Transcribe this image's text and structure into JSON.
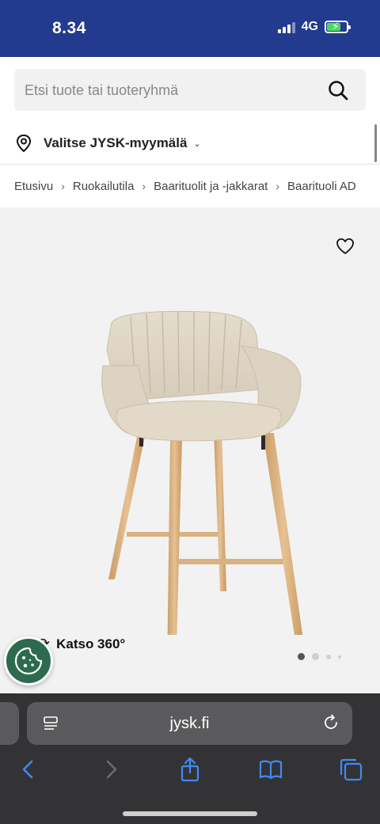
{
  "status_bar": {
    "time": "8.34",
    "network": "4G",
    "battery_charging": true
  },
  "search": {
    "placeholder": "Etsi tuote tai tuoteryhmä"
  },
  "store": {
    "label": "Valitse JYSK-myymälä"
  },
  "breadcrumb": {
    "items": [
      "Etusivu",
      "Ruokailutila",
      "Baarituolit ja -jakkarat",
      "Baarituoli AD"
    ],
    "separator": "›"
  },
  "product": {
    "view360_label": "Katso 360°",
    "gallery": {
      "current_image": 1,
      "visible_dots": 4
    }
  },
  "browser": {
    "url": "jysk.fi"
  },
  "colors": {
    "header": "#233b8e",
    "browser_bar": "#333335",
    "cookie_button": "#2d6a4f"
  }
}
